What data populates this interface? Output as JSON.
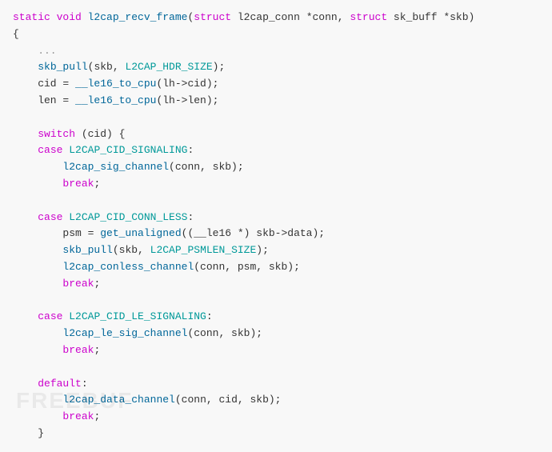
{
  "code": {
    "lines": [
      {
        "id": 1,
        "tokens": [
          {
            "text": "static void ",
            "class": "kw"
          },
          {
            "text": "l2cap_recv_frame",
            "class": "func-name"
          },
          {
            "text": "(",
            "class": "plain"
          },
          {
            "text": "struct ",
            "class": "kw"
          },
          {
            "text": "l2cap_conn",
            "class": "plain"
          },
          {
            "text": " *conn, ",
            "class": "plain"
          },
          {
            "text": "struct ",
            "class": "kw"
          },
          {
            "text": "sk_buff",
            "class": "plain"
          },
          {
            "text": " *skb)",
            "class": "plain"
          }
        ]
      },
      {
        "id": 2,
        "tokens": [
          {
            "text": "{",
            "class": "plain"
          }
        ]
      },
      {
        "id": 3,
        "tokens": [
          {
            "text": "    ...",
            "class": "comment"
          }
        ]
      },
      {
        "id": 4,
        "tokens": [
          {
            "text": "    ",
            "class": "plain"
          },
          {
            "text": "skb_pull",
            "class": "func-name"
          },
          {
            "text": "(skb, ",
            "class": "plain"
          },
          {
            "text": "L2CAP_HDR_SIZE",
            "class": "const"
          },
          {
            "text": ");",
            "class": "plain"
          }
        ]
      },
      {
        "id": 5,
        "tokens": [
          {
            "text": "    cid = ",
            "class": "plain"
          },
          {
            "text": "__le16_to_cpu",
            "class": "func-name"
          },
          {
            "text": "(lh->cid);",
            "class": "plain"
          }
        ]
      },
      {
        "id": 6,
        "tokens": [
          {
            "text": "    len = ",
            "class": "plain"
          },
          {
            "text": "__le16_to_cpu",
            "class": "func-name"
          },
          {
            "text": "(lh->len);",
            "class": "plain"
          }
        ]
      },
      {
        "id": 7,
        "tokens": [
          {
            "text": "",
            "class": "plain"
          }
        ]
      },
      {
        "id": 8,
        "tokens": [
          {
            "text": "    ",
            "class": "plain"
          },
          {
            "text": "switch",
            "class": "kw"
          },
          {
            "text": " (cid) {",
            "class": "plain"
          }
        ]
      },
      {
        "id": 9,
        "tokens": [
          {
            "text": "    ",
            "class": "plain"
          },
          {
            "text": "case ",
            "class": "kw"
          },
          {
            "text": "L2CAP_CID_SIGNALING",
            "class": "const"
          },
          {
            "text": ":",
            "class": "plain"
          }
        ]
      },
      {
        "id": 10,
        "tokens": [
          {
            "text": "        ",
            "class": "plain"
          },
          {
            "text": "l2cap_sig_channel",
            "class": "func-name"
          },
          {
            "text": "(conn, skb);",
            "class": "plain"
          }
        ]
      },
      {
        "id": 11,
        "tokens": [
          {
            "text": "        ",
            "class": "plain"
          },
          {
            "text": "break",
            "class": "kw"
          },
          {
            "text": ";",
            "class": "plain"
          }
        ]
      },
      {
        "id": 12,
        "tokens": [
          {
            "text": "",
            "class": "plain"
          }
        ]
      },
      {
        "id": 13,
        "tokens": [
          {
            "text": "    ",
            "class": "plain"
          },
          {
            "text": "case ",
            "class": "kw"
          },
          {
            "text": "L2CAP_CID_CONN_LESS",
            "class": "const"
          },
          {
            "text": ":",
            "class": "plain"
          }
        ]
      },
      {
        "id": 14,
        "tokens": [
          {
            "text": "        psm = ",
            "class": "plain"
          },
          {
            "text": "get_unaligned",
            "class": "func-name"
          },
          {
            "text": "((",
            "class": "plain"
          },
          {
            "text": "__le16",
            "class": "plain"
          },
          {
            "text": " *) skb->data);",
            "class": "plain"
          }
        ]
      },
      {
        "id": 15,
        "tokens": [
          {
            "text": "        ",
            "class": "plain"
          },
          {
            "text": "skb_pull",
            "class": "func-name"
          },
          {
            "text": "(skb, ",
            "class": "plain"
          },
          {
            "text": "L2CAP_PSMLEN_SIZE",
            "class": "const"
          },
          {
            "text": ");",
            "class": "plain"
          }
        ]
      },
      {
        "id": 16,
        "tokens": [
          {
            "text": "        ",
            "class": "plain"
          },
          {
            "text": "l2cap_conless_channel",
            "class": "func-name"
          },
          {
            "text": "(conn, psm, skb);",
            "class": "plain"
          }
        ]
      },
      {
        "id": 17,
        "tokens": [
          {
            "text": "        ",
            "class": "plain"
          },
          {
            "text": "break",
            "class": "kw"
          },
          {
            "text": ";",
            "class": "plain"
          }
        ]
      },
      {
        "id": 18,
        "tokens": [
          {
            "text": "",
            "class": "plain"
          }
        ]
      },
      {
        "id": 19,
        "tokens": [
          {
            "text": "    ",
            "class": "plain"
          },
          {
            "text": "case ",
            "class": "kw"
          },
          {
            "text": "L2CAP_CID_LE_SIGNALING",
            "class": "const"
          },
          {
            "text": ":",
            "class": "plain"
          }
        ]
      },
      {
        "id": 20,
        "tokens": [
          {
            "text": "        ",
            "class": "plain"
          },
          {
            "text": "l2cap_le_sig_channel",
            "class": "func-name"
          },
          {
            "text": "(conn, skb);",
            "class": "plain"
          }
        ]
      },
      {
        "id": 21,
        "tokens": [
          {
            "text": "        ",
            "class": "plain"
          },
          {
            "text": "break",
            "class": "kw"
          },
          {
            "text": ";",
            "class": "plain"
          }
        ]
      },
      {
        "id": 22,
        "tokens": [
          {
            "text": "",
            "class": "plain"
          }
        ]
      },
      {
        "id": 23,
        "tokens": [
          {
            "text": "    ",
            "class": "plain"
          },
          {
            "text": "default",
            "class": "kw"
          },
          {
            "text": ":",
            "class": "plain"
          }
        ]
      },
      {
        "id": 24,
        "tokens": [
          {
            "text": "        ",
            "class": "plain"
          },
          {
            "text": "l2cap_data_channel",
            "class": "func-name"
          },
          {
            "text": "(conn, cid, skb);",
            "class": "plain"
          }
        ]
      },
      {
        "id": 25,
        "tokens": [
          {
            "text": "        ",
            "class": "plain"
          },
          {
            "text": "break",
            "class": "kw"
          },
          {
            "text": ";",
            "class": "plain"
          }
        ]
      },
      {
        "id": 26,
        "tokens": [
          {
            "text": "    }",
            "class": "plain"
          }
        ]
      }
    ]
  },
  "watermark": "FREEBUF"
}
